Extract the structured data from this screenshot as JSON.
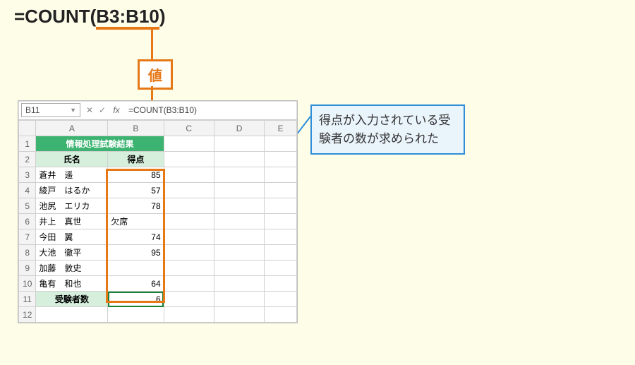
{
  "formula_display": "=COUNT(B3:B10)",
  "formula_parts": {
    "pre": "=COUNT(",
    "range": "B3:B10",
    "post": ")"
  },
  "value_label": "値",
  "callout_text": "得点が入力されている受験者の数が求められた",
  "namebox": "B11",
  "fx_formula": "=COUNT(B3:B10)",
  "columns": [
    "A",
    "B",
    "C",
    "D",
    "E"
  ],
  "sheet": {
    "title": "情報処理試験結果",
    "headers": {
      "name": "氏名",
      "score": "得点"
    },
    "rows": [
      {
        "r": 3,
        "name": "蒼井　遥",
        "score": "85"
      },
      {
        "r": 4,
        "name": "綾戸　はるか",
        "score": "57"
      },
      {
        "r": 5,
        "name": "池尻　エリカ",
        "score": "78"
      },
      {
        "r": 6,
        "name": "井上　真世",
        "score": "欠席"
      },
      {
        "r": 7,
        "name": "今田　翼",
        "score": "74"
      },
      {
        "r": 8,
        "name": "大池　徹平",
        "score": "95"
      },
      {
        "r": 9,
        "name": "加藤　敦史",
        "score": ""
      },
      {
        "r": 10,
        "name": "亀有　和也",
        "score": "64"
      }
    ],
    "summary": {
      "label": "受験者数",
      "value": "6",
      "row": 11
    },
    "extra_row": 12
  }
}
